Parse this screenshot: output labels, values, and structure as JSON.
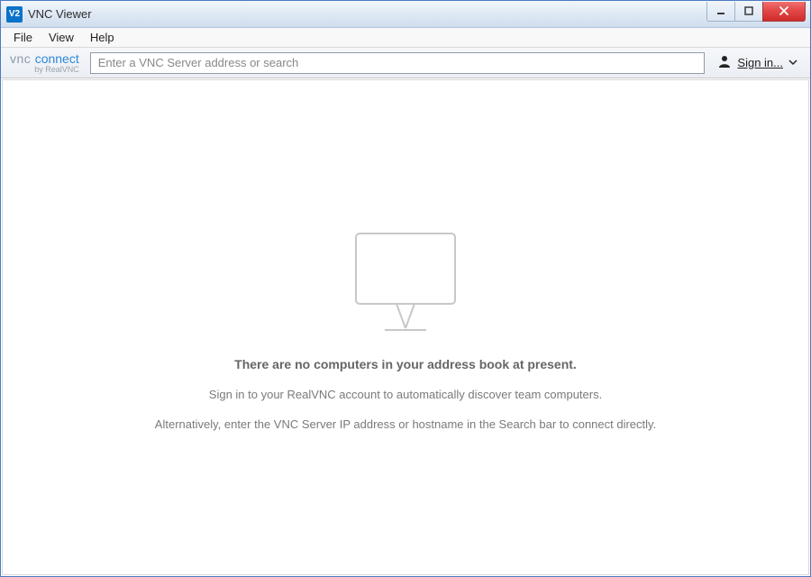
{
  "window": {
    "title": "VNC Viewer"
  },
  "menu": {
    "file": "File",
    "view": "View",
    "help": "Help"
  },
  "toolbar": {
    "logo_vnc": "vnc",
    "logo_connect": "connect",
    "logo_sub": "by RealVNC",
    "search_placeholder": "Enter a VNC Server address or search",
    "signin_label": "Sign in..."
  },
  "empty": {
    "heading": "There are no computers in your address book at present.",
    "line1": "Sign in to your RealVNC account to automatically discover team computers.",
    "line2": "Alternatively, enter the VNC Server IP address or hostname in the Search bar to connect directly."
  },
  "app_icon_text": "V2"
}
